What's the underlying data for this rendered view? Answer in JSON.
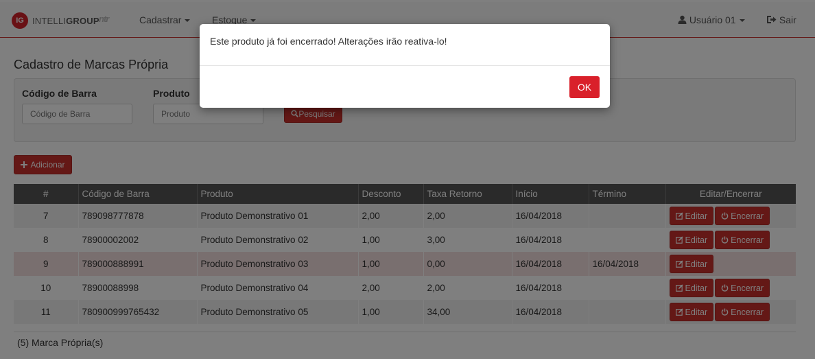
{
  "navbar": {
    "logo_badge": "IG",
    "logo_text_light": "INTELLI",
    "logo_text_bold": "GROUP",
    "partner_mark": "ntr",
    "menu_cadastrar": "Cadastrar",
    "menu_estoque": "Estoque",
    "user": "Usuário 01",
    "logout": "Sair",
    "user_icon": "user-icon",
    "logout_icon": "sign-out-icon"
  },
  "page": {
    "title": "Cadastro de Marcas Própria",
    "filters": {
      "barcode_label": "Código de Barra",
      "barcode_placeholder": "Código de Barra",
      "product_label": "Produto",
      "product_placeholder": "Produto",
      "search_button": "Pesquisar",
      "search_icon": "search-icon"
    },
    "add_button": "Adicionar",
    "add_icon": "plus-icon"
  },
  "table": {
    "headers": [
      "#",
      "Código de Barra",
      "Produto",
      "Desconto",
      "Taxa Retorno",
      "Início",
      "Término",
      "Editar/Encerrar"
    ],
    "edit_label": "Editar",
    "close_label": "Encerrar",
    "rows": [
      {
        "id": "7",
        "barcode": "789098777878",
        "product": "Produto Demonstrativo 01",
        "discount": "2,00",
        "rate": "2,00",
        "start": "16/04/2018",
        "end": ""
      },
      {
        "id": "8",
        "barcode": "78900002002",
        "product": "Produto Demonstrativo 02",
        "discount": "1,00",
        "rate": "3,00",
        "start": "16/04/2018",
        "end": ""
      },
      {
        "id": "9",
        "barcode": "789000888991",
        "product": "Produto Demonstrativo 03",
        "discount": "1,00",
        "rate": "0,00",
        "start": "16/04/2018",
        "end": "16/04/2018"
      },
      {
        "id": "10",
        "barcode": "78900088998",
        "product": "Produto Demonstrativo 04",
        "discount": "2,00",
        "rate": "2,00",
        "start": "16/04/2018",
        "end": ""
      },
      {
        "id": "11",
        "barcode": "780900999765432",
        "product": "Produto Demonstrativo 05",
        "discount": "1,00",
        "rate": "34,00",
        "start": "16/04/2018",
        "end": ""
      }
    ],
    "footer": "(5) Marca Própria(s)"
  },
  "modal": {
    "message": "Este produto já foi encerrado! Alterações irão reativa-lo!",
    "ok_button": "OK"
  },
  "colors": {
    "brand_red": "#d2232a",
    "button_red": "#c9302c",
    "header_gray": "#555555",
    "danger_row": "#f2dede"
  }
}
